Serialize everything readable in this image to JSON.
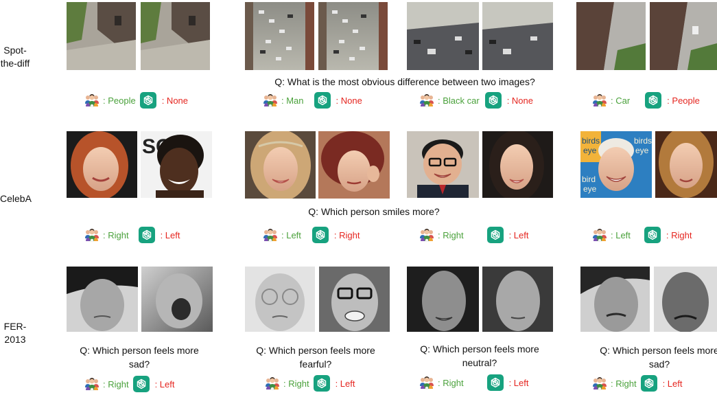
{
  "colors": {
    "human_answer": "#4aa13b",
    "gpt_answer": "#e5251f",
    "gpt_icon_bg": "#17a27f"
  },
  "icons": {
    "human": "people-icon",
    "gpt": "chatgpt-icon"
  },
  "rows": [
    {
      "label": "Spot-\nthe-diff",
      "question": "Q: What is the most obvious difference between two images?",
      "groups": [
        {
          "human": ": People",
          "gpt": ": None"
        },
        {
          "human": ": Man",
          "gpt": ": None"
        },
        {
          "human": ": Black car",
          "gpt": ": None"
        },
        {
          "human": ": Car",
          "gpt": ": People"
        }
      ]
    },
    {
      "label": "CelebA",
      "question": "Q: Which person smiles more?",
      "groups": [
        {
          "human": ": Right",
          "gpt": ": Left"
        },
        {
          "human": ": Left",
          "gpt": ": Right"
        },
        {
          "human": ": Right",
          "gpt": ": Left"
        },
        {
          "human": ": Left",
          "gpt": ": Right"
        }
      ],
      "billboard_text": [
        "birds",
        "eye",
        "bird",
        "eye",
        "birds",
        "eye"
      ]
    },
    {
      "label": "FER-\n2013",
      "groups": [
        {
          "question": "Q: Which person feels more sad?",
          "human": ": Right",
          "gpt": ": Left"
        },
        {
          "question": "Q: Which person feels more fearful?",
          "human": ": Right",
          "gpt": ": Left"
        },
        {
          "question": "Q: Which person feels more neutral?",
          "human": ": Right",
          "gpt": ": Left"
        },
        {
          "question": "Q: Which person feels more sad?",
          "human": ": Right",
          "gpt": ": Left"
        }
      ]
    }
  ]
}
